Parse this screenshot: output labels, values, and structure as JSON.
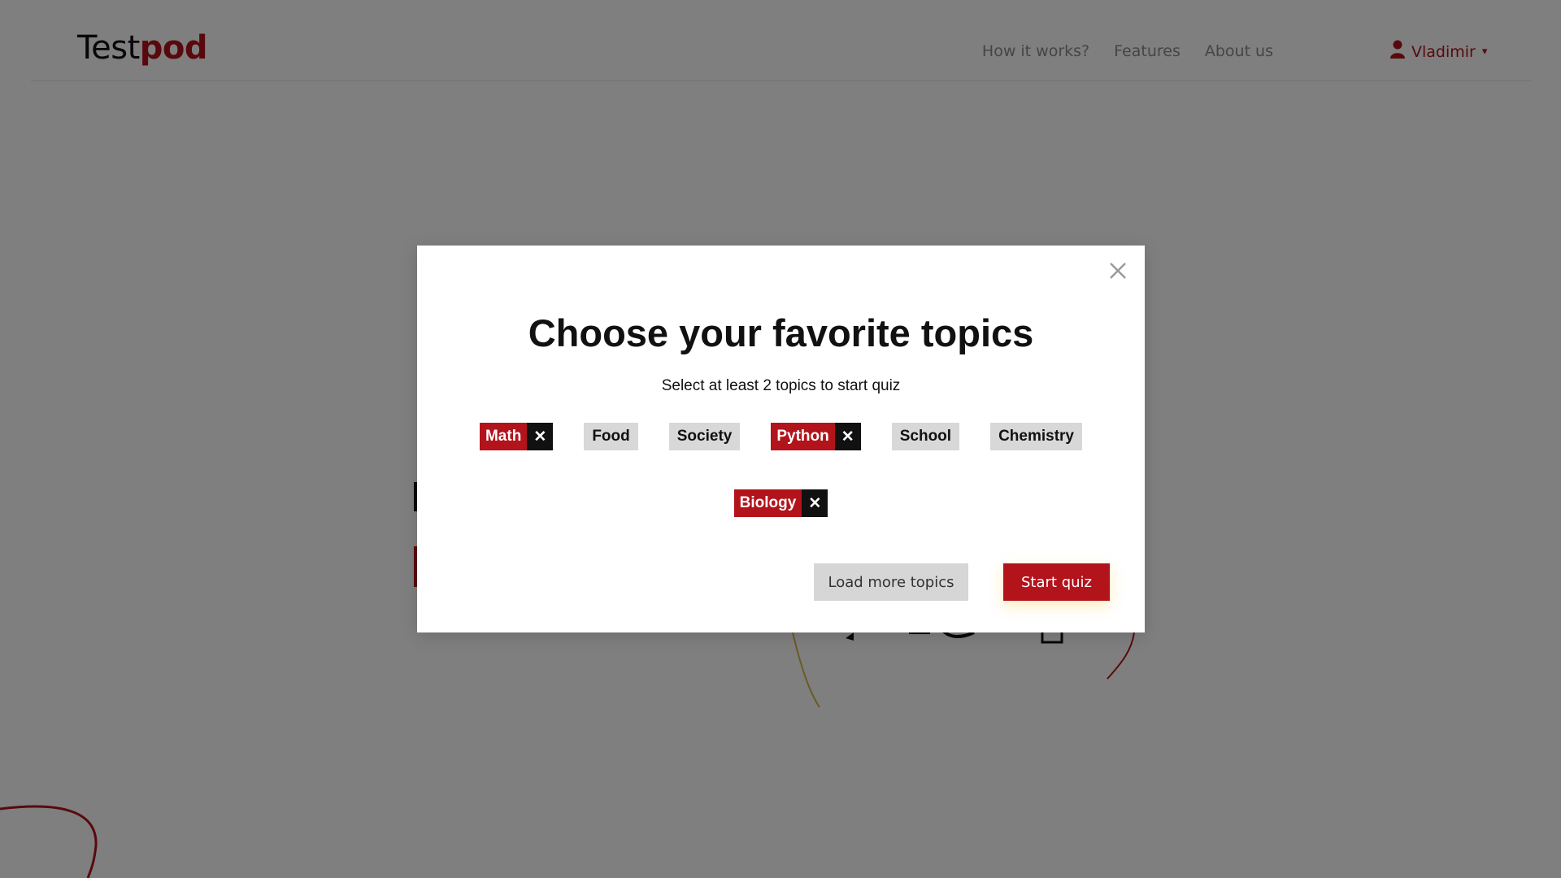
{
  "header": {
    "logo_text_dark": "Test",
    "logo_text_accent": "pod",
    "nav": [
      "How it works?",
      "Features",
      "About us"
    ],
    "user": {
      "name": "Vladimir",
      "caret": "▾"
    }
  },
  "modal": {
    "title": "Choose your favorite topics",
    "subtitle": "Select at least 2 topics to start quiz",
    "topics_row1": [
      {
        "label": "Math",
        "selected": true
      },
      {
        "label": "Food",
        "selected": false
      },
      {
        "label": "Society",
        "selected": false
      },
      {
        "label": "Python",
        "selected": true
      },
      {
        "label": "School",
        "selected": false
      },
      {
        "label": "Chemistry",
        "selected": false
      }
    ],
    "topics_row2": [
      {
        "label": "Biology",
        "selected": true
      }
    ],
    "remove_symbol": "✕",
    "load_more_label": "Load more topics",
    "start_label": "Start quiz"
  },
  "colors": {
    "accent": "#b3131b",
    "chip_unselected": "#d8d8d8",
    "overlay": "rgba(0,0,0,0.5)"
  },
  "icons": {
    "close": "close-icon",
    "user": "user-icon",
    "remove": "remove-topic-icon"
  }
}
